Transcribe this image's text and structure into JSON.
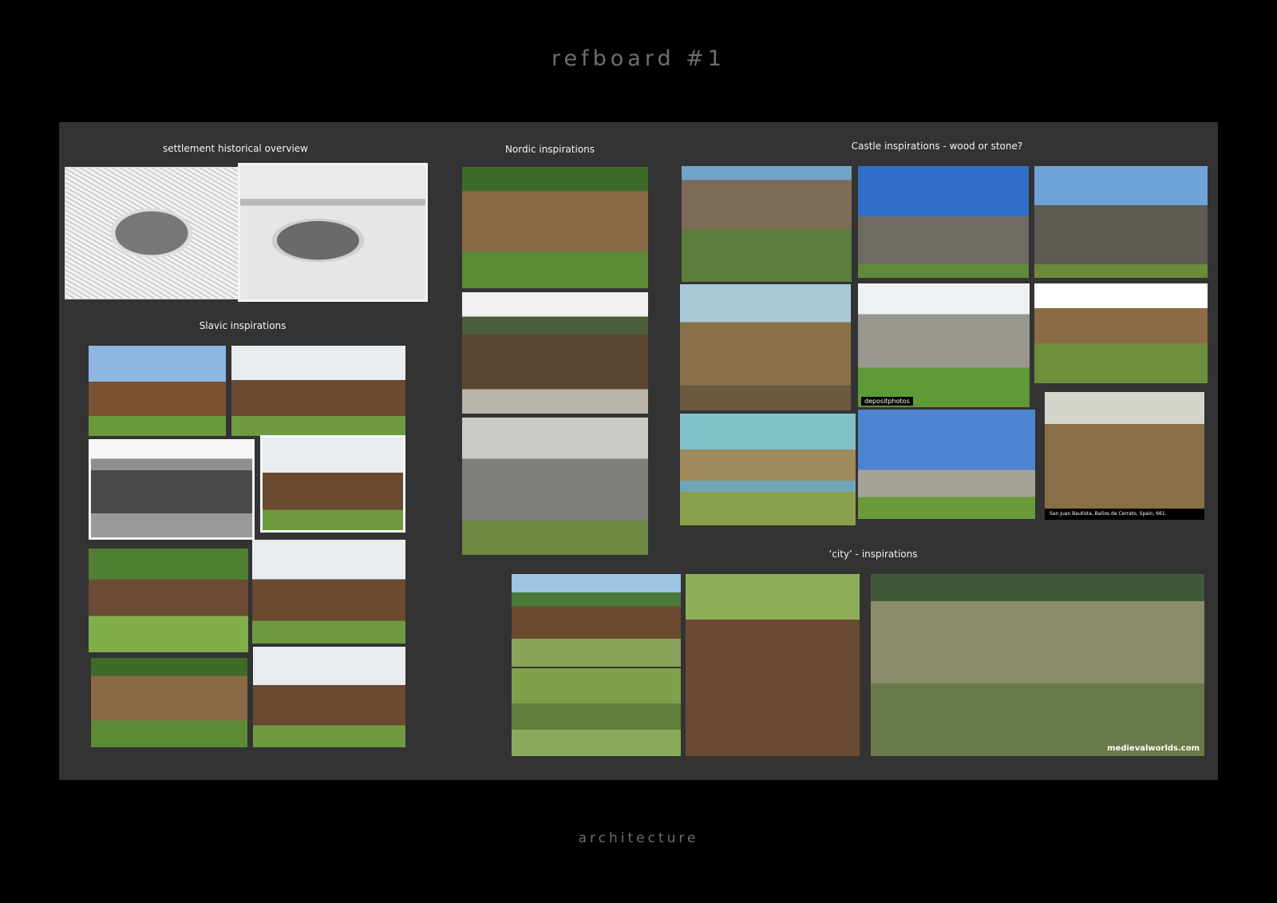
{
  "title": "refboard #1",
  "footer": "architecture",
  "sections": {
    "settlement": "settlement historical overview",
    "slavic": "Slavic inspirations",
    "nordic": "Nordic inspirations",
    "castle": "Castle inspirations - wood or stone?",
    "city": "‘city’ - inspirations"
  },
  "watermarks": {
    "depositphotos": "depositphotos",
    "medievalworlds": "medievalworlds.com",
    "castle_caption": "San Juan Bautista, Baños de Cerrato, Spain, 661."
  }
}
